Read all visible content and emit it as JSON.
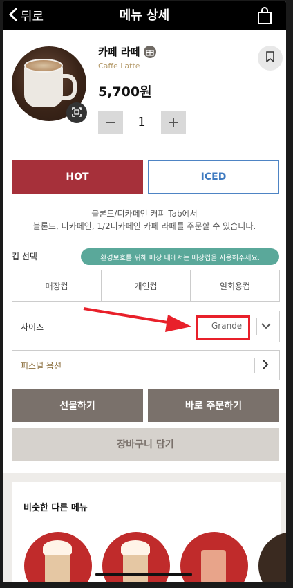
{
  "header": {
    "back_label": "뒤로",
    "title": "메뉴 상세"
  },
  "product": {
    "name_ko": "카페 라떼",
    "name_en": "Caffe Latte",
    "price": "5,700원",
    "quantity": "1"
  },
  "temperature": {
    "hot": "HOT",
    "iced": "ICED",
    "selected": "HOT"
  },
  "notice": {
    "line1": "블론드/디카페인 커피 Tab에서",
    "line2": "블론드, 디카페인, 1/2디카페인 카페 라떼를 주문할 수 있습니다."
  },
  "cup": {
    "label": "컵 선택",
    "eco_badge": "환경보호를 위해 매장 내에서는 매장컵을 사용해주세요.",
    "options": [
      "매장컵",
      "개인컵",
      "일회용컵"
    ]
  },
  "size": {
    "label": "사이즈",
    "value": "Grande"
  },
  "personal": {
    "label": "퍼스널 옵션"
  },
  "actions": {
    "gift": "선물하기",
    "order": "바로 주문하기",
    "cart": "장바구니 담기"
  },
  "similar": {
    "title": "비슷한 다른 메뉴"
  },
  "colors": {
    "hot": "#a6303a",
    "iced": "#3e7ac0",
    "action": "#7a716b",
    "eco": "#5aa89a",
    "highlight": "#e8202a"
  },
  "icons": [
    "chevron-left-icon",
    "shopping-bag-icon",
    "gift-icon",
    "bookmark-icon",
    "expand-icon",
    "minus-icon",
    "plus-icon",
    "chevron-down-icon",
    "chevron-right-icon"
  ]
}
